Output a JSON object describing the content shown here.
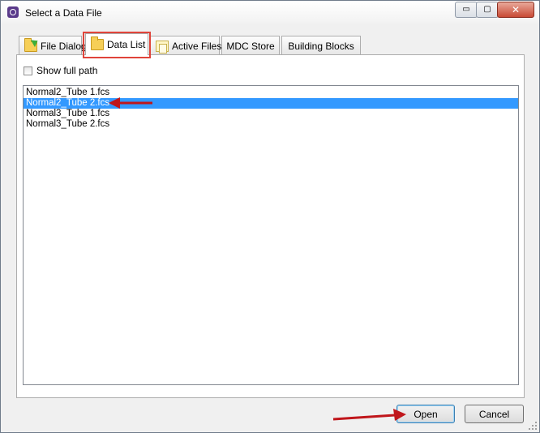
{
  "window": {
    "title": "Select a Data File"
  },
  "caption_buttons": {
    "minimize_glyph": "▭",
    "maximize_glyph": "▢",
    "close_glyph": "✕"
  },
  "tabs": [
    {
      "label": "File Dialog",
      "icon": "folder-arrow-icon"
    },
    {
      "label": "Data List",
      "icon": "folder-icon",
      "selected": true
    },
    {
      "label": "Active Files",
      "icon": "files-icon"
    },
    {
      "label": "MDC Store",
      "icon": ""
    },
    {
      "label": "Building Blocks",
      "icon": ""
    }
  ],
  "show_full_path": {
    "label": "Show full path",
    "checked": false
  },
  "file_list": {
    "items": [
      "Normal2_Tube 1.fcs",
      "Normal2_Tube 2.fcs",
      "Normal3_Tube 1.fcs",
      "Normal3_Tube 2.fcs"
    ],
    "selected_index": 1
  },
  "buttons": {
    "open": "Open",
    "cancel": "Cancel"
  },
  "colors": {
    "selection": "#3399ff",
    "annotation_red": "#c0161b",
    "highlight_box": "#e0443a"
  }
}
